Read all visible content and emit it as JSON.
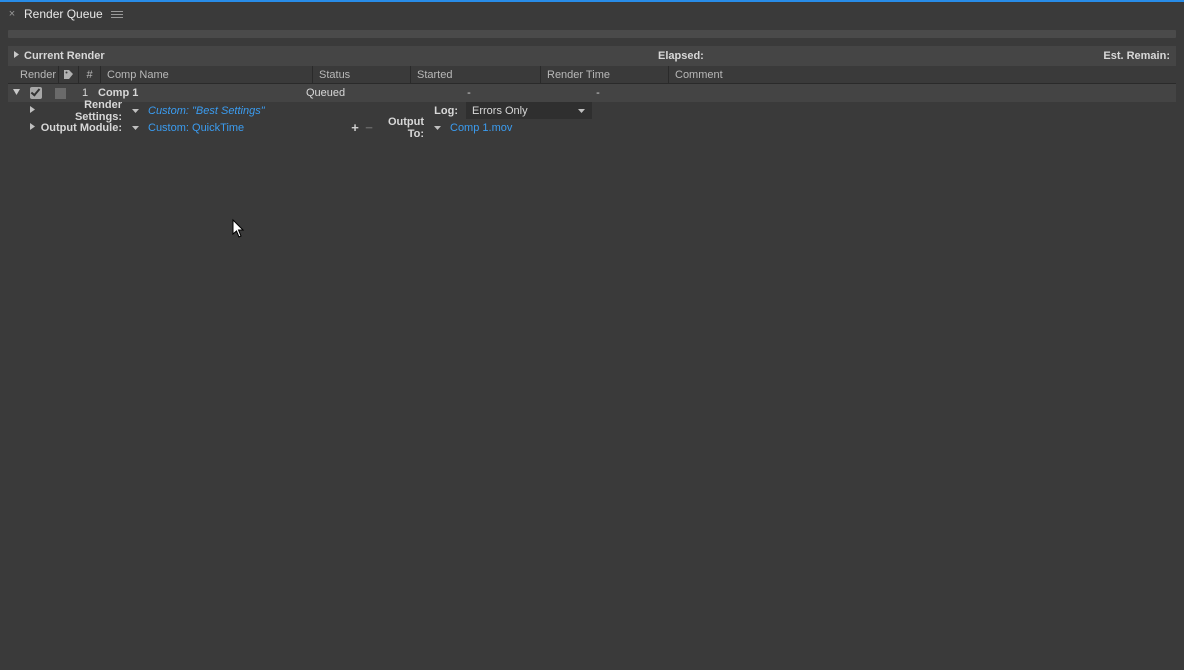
{
  "panel": {
    "title": "Render Queue",
    "current_render_label": "Current Render",
    "elapsed_label": "Elapsed:",
    "est_remain_label": "Est. Remain:"
  },
  "columns": {
    "render": "Render",
    "num": "#",
    "comp_name": "Comp Name",
    "status": "Status",
    "started": "Started",
    "render_time": "Render Time",
    "comment": "Comment"
  },
  "item": {
    "num": "1",
    "name": "Comp 1",
    "status": "Queued",
    "started": "-",
    "render_time": "-"
  },
  "details": {
    "render_settings_label": "Render Settings:",
    "render_settings_value": "Custom: \"Best Settings\"",
    "output_module_label": "Output Module:",
    "output_module_value": "Custom: QuickTime",
    "log_label": "Log:",
    "log_value": "Errors Only",
    "output_to_label": "Output To:",
    "output_to_value": "Comp 1.mov"
  }
}
